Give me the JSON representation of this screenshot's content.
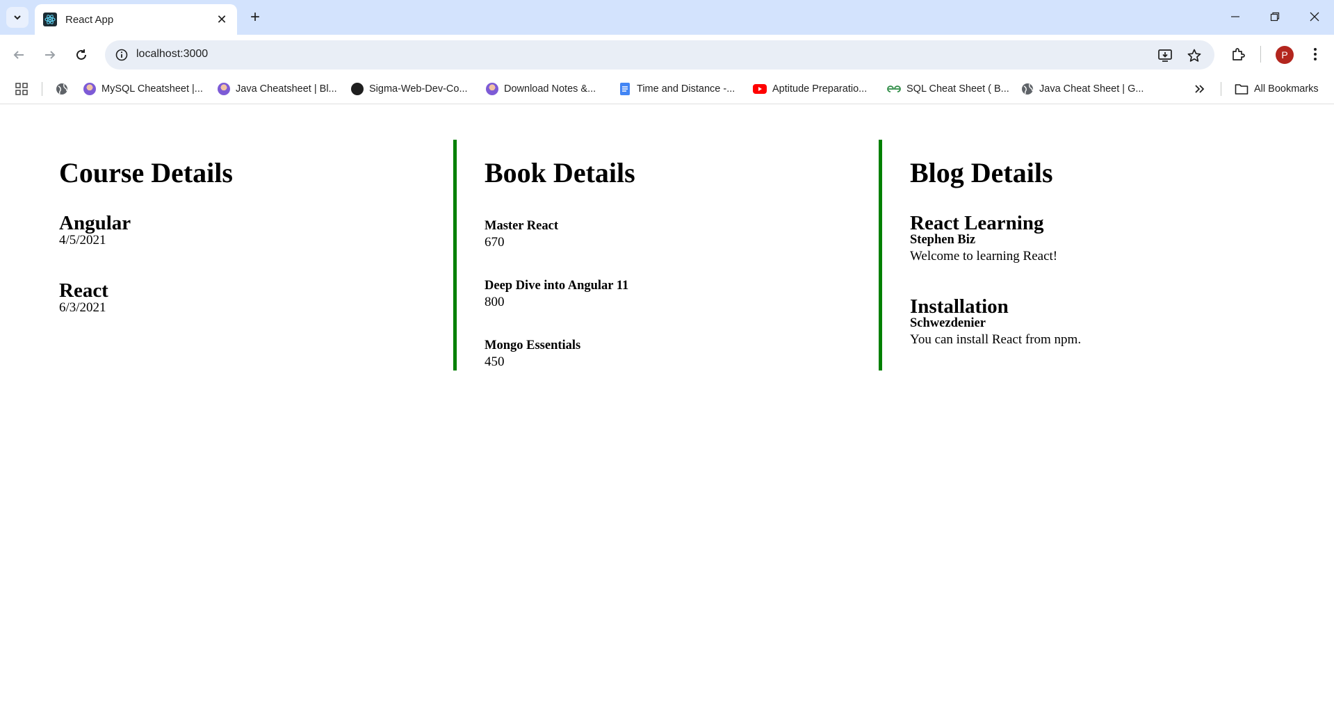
{
  "browser": {
    "tab_title": "React App",
    "url": "localhost:3000",
    "profile_initial": "P",
    "bookmarks": [
      {
        "label": "MySQL Cheatsheet |..."
      },
      {
        "label": "Java Cheatsheet | Bl..."
      },
      {
        "label": "Sigma-Web-Dev-Co..."
      },
      {
        "label": "Download Notes &..."
      },
      {
        "label": "Time and Distance -..."
      },
      {
        "label": "Aptitude Preparatio..."
      },
      {
        "label": "SQL Cheat Sheet ( B..."
      },
      {
        "label": "Java Cheat Sheet | G..."
      }
    ],
    "all_bookmarks": "All Bookmarks",
    "accent_green": "#008000"
  },
  "courses": {
    "heading": "Course Details",
    "items": [
      {
        "name": "Angular",
        "date": "4/5/2021"
      },
      {
        "name": "React",
        "date": "6/3/2021"
      }
    ]
  },
  "books": {
    "heading": "Book Details",
    "items": [
      {
        "name": "Master React",
        "price": "670"
      },
      {
        "name": "Deep Dive into Angular 11",
        "price": "800"
      },
      {
        "name": "Mongo Essentials",
        "price": "450"
      }
    ]
  },
  "blogs": {
    "heading": "Blog Details",
    "items": [
      {
        "title": "React Learning",
        "author": "Stephen Biz",
        "content": "Welcome to learning React!"
      },
      {
        "title": "Installation",
        "author": "Schwezdenier",
        "content": "You can install React from npm."
      }
    ]
  }
}
